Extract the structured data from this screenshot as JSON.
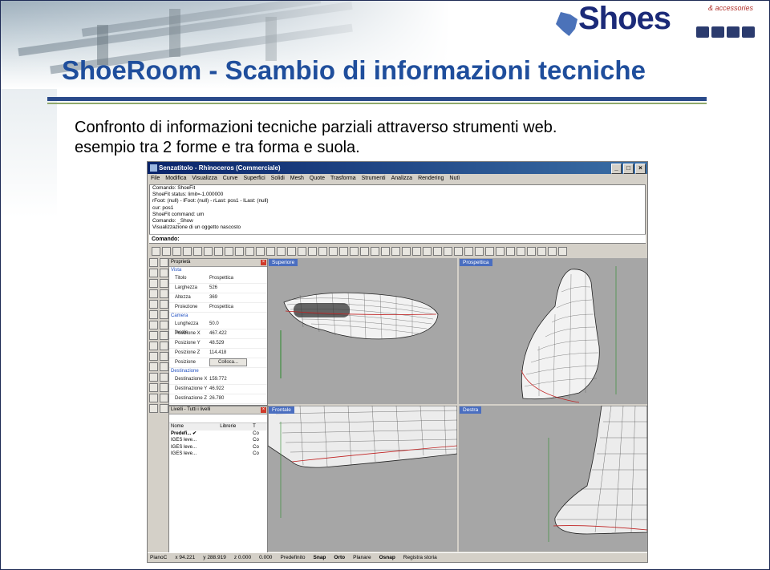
{
  "slide": {
    "title": "ShoeRoom - Scambio di informazioni tecniche",
    "body_line1": "Confronto di informazioni tecniche parziali attraverso strumenti web.",
    "body_line2": "esempio tra 2 forme e tra forma e suola.",
    "logo_text": "Shoes",
    "logo_subtitle": "& accessories",
    "accent": "#1f4e9c"
  },
  "window": {
    "title": "Senzatitolo - Rhinoceros (Commerciale)",
    "menu": [
      "File",
      "Modifica",
      "Visualizza",
      "Curve",
      "Superfici",
      "Solidi",
      "Mesh",
      "Quote",
      "Trasforma",
      "Strumenti",
      "Analizza",
      "Rendering",
      "Nutì"
    ],
    "command_history": [
      "Comando: ShoeFit",
      "ShoeFit status: limit=-1.000000",
      "rFoot: (null) - lFoot: (null) - rLast: pos1 - lLast: (null)",
      "cur: pos1",
      "ShoeFit command: um",
      "Comando: _Show",
      "Visualizzazione di un oggetto nascosto"
    ],
    "command_prompt": "Comando:",
    "properties": {
      "header": "Proprietà",
      "section_view": "Vista",
      "rows_view": [
        {
          "k": "Titolo",
          "v": "Prospettica"
        },
        {
          "k": "Larghezza",
          "v": "526"
        },
        {
          "k": "Altezza",
          "v": "369"
        },
        {
          "k": "Proiezione",
          "v": "Prospettica"
        }
      ],
      "section_camera": "Camera",
      "rows_camera": [
        {
          "k": "Lunghezza focale",
          "v": "50.0"
        },
        {
          "k": "Posizione X",
          "v": "467.422"
        },
        {
          "k": "Posizione Y",
          "v": "48.529"
        },
        {
          "k": "Posizione Z",
          "v": "114.418"
        },
        {
          "k": "Posizione",
          "v": "Colloca..."
        }
      ],
      "section_target": "Destinazione",
      "rows_target": [
        {
          "k": "Destinazione X",
          "v": "159.772"
        },
        {
          "k": "Destinazione Y",
          "v": "46.922"
        },
        {
          "k": "Destinazione Z",
          "v": "26.780"
        }
      ]
    },
    "layers": {
      "header": "Livelli - Tutti i livelli",
      "columns": [
        "Nome",
        "Librerie",
        "T"
      ],
      "rows": [
        {
          "name": "Predefi... ✔",
          "lib": "",
          "t": "Co"
        },
        {
          "name": "IGES leve...",
          "lib": "",
          "t": "Co"
        },
        {
          "name": "IGES leve...",
          "lib": "",
          "t": "Co"
        },
        {
          "name": "IGES leve...",
          "lib": "",
          "t": "Co"
        }
      ]
    },
    "viewports": {
      "top": "Superiore",
      "perspective": "Prospettica",
      "front": "Frontale",
      "right": "Destra"
    },
    "status": {
      "plane": "PianoC",
      "x": "x 94.221",
      "y": "y 288.919",
      "z": "z 0.000",
      "w": "0.000",
      "layer": "Predefinito",
      "snap": "Snap",
      "orto": "Orto",
      "planar": "Planare",
      "osnap": "Osnap",
      "history": "Registra storia"
    },
    "colors": {
      "titlebar": "#0a246a",
      "viewport_bg": "#a6a6a6",
      "viewport_label": "#4a6ec0"
    }
  }
}
